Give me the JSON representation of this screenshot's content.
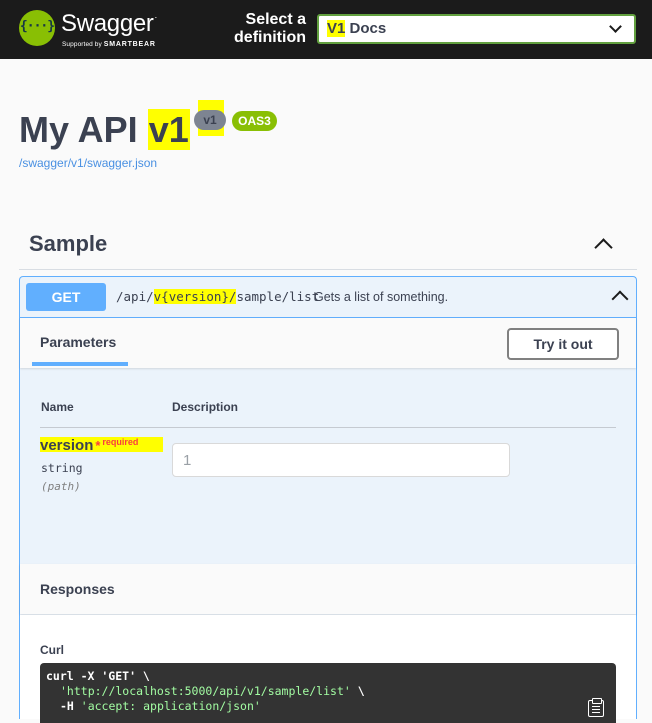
{
  "topbar": {
    "brand": "Swagger",
    "brand_sub_prefix": "Supported by ",
    "brand_sub_company": "SMARTBEAR",
    "logo_glyph": "{···}",
    "select_label": "Select a definition",
    "selected_definition_highlight": "V1",
    "selected_definition_rest": " Docs"
  },
  "info": {
    "title_prefix": "My API ",
    "title_version": "v1",
    "version_badge": "v1",
    "oas_badge": "OAS3",
    "spec_link": "/swagger/v1/swagger.json"
  },
  "tag": {
    "name": "Sample"
  },
  "operation": {
    "method": "GET",
    "path_prefix": "/api/",
    "path_highlight": "v{version}/",
    "path_suffix": "sample/list",
    "summary": "Gets a list of something.",
    "parameters_tab": "Parameters",
    "try_button": "Try it out",
    "col_name": "Name",
    "col_description": "Description",
    "parameter": {
      "name": "version",
      "required_star": "*",
      "required_label": "required",
      "type": "string",
      "in": "(path)",
      "value": "1"
    },
    "responses_title": "Responses",
    "curl_label": "Curl",
    "curl": {
      "line1": "curl -X 'GET' \\",
      "line2_url": "'http://localhost:5000/api/v1/sample/list'",
      "line2_cont": " \\",
      "line3_flag": "-H ",
      "line3_header": "'accept: application/json'"
    }
  },
  "colors": {
    "topbar_bg": "#1b1b1b",
    "brand_green": "#89bf04",
    "get_blue": "#61affe",
    "highlight": "#ffff00",
    "required_red": "#f93e3e"
  }
}
